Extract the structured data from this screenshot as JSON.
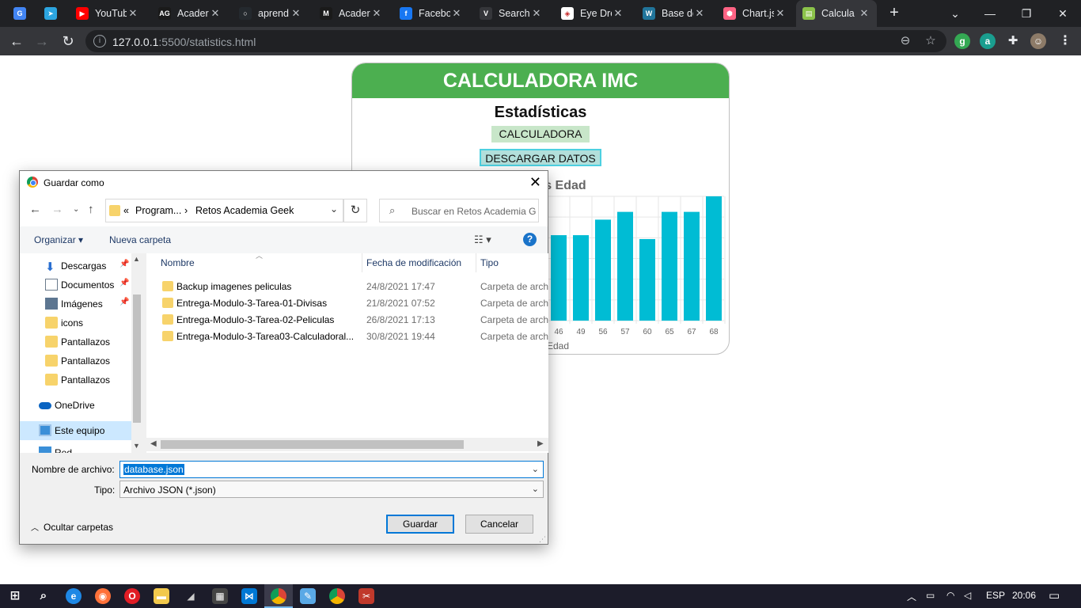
{
  "browser": {
    "tabs": [
      {
        "title": "",
        "color": "#4285f4",
        "glyph": "G"
      },
      {
        "title": "",
        "color": "#2ca5e0",
        "glyph": "➤"
      },
      {
        "title": "YouTub",
        "color": "#ff0000",
        "glyph": "▶"
      },
      {
        "title": "Acader",
        "color": "#1a1a1a",
        "glyph": "AG"
      },
      {
        "title": "aprend",
        "color": "#24292e",
        "glyph": "○"
      },
      {
        "title": "Acader",
        "color": "#1a1a1a",
        "glyph": "M"
      },
      {
        "title": "Facebo",
        "color": "#1877f2",
        "glyph": "f"
      },
      {
        "title": "Search",
        "color": "#35363a",
        "glyph": "V"
      },
      {
        "title": "Eye Dro",
        "color": "#ffffff",
        "glyph": "◈"
      },
      {
        "title": "Base de",
        "color": "#21759b",
        "glyph": "W"
      },
      {
        "title": "Chart.js",
        "color": "#ff6384",
        "glyph": "⬢"
      },
      {
        "title": "Calcula",
        "color": "#8bc34a",
        "glyph": "▤"
      }
    ],
    "url_host": "127.0.0.1",
    "url_path": ":5500/statistics.html"
  },
  "page": {
    "header": "CALCULADORA IMC",
    "subtitle": "Estadísticas",
    "calc_button": "CALCULADORA",
    "download_button": "DESCARGAR DATOS",
    "chart_title_visible": "C vs Edad"
  },
  "chart_data": {
    "type": "bar",
    "title": "IMC vs Edad",
    "xlabel": "Edad",
    "categories": [
      "46",
      "49",
      "56",
      "57",
      "60",
      "65",
      "67",
      "68"
    ],
    "values": [
      22,
      22,
      26,
      28,
      21,
      28,
      28,
      32
    ],
    "ylim": [
      0,
      32
    ],
    "grid": true,
    "bar_color": "#00bcd4"
  },
  "dialog": {
    "title": "Guardar como",
    "path_prefix": "«",
    "path_segment_1": "Program...",
    "path_segment_2": "Retos Academia Geek",
    "search_placeholder": "Buscar en Retos Academia G...",
    "organize": "Organizar ▾",
    "new_folder": "Nueva carpeta",
    "nav_items": [
      {
        "label": "Descargas",
        "pinned": true
      },
      {
        "label": "Documentos",
        "pinned": true
      },
      {
        "label": "Imágenes",
        "pinned": true
      },
      {
        "label": "icons",
        "pinned": false
      },
      {
        "label": "Pantallazos",
        "pinned": false
      },
      {
        "label": "Pantallazos",
        "pinned": false
      },
      {
        "label": "Pantallazos",
        "pinned": false
      },
      {
        "label": "OneDrive",
        "pinned": false
      },
      {
        "label": "Este equipo",
        "pinned": false
      },
      {
        "label": "Red",
        "pinned": false
      }
    ],
    "columns": [
      "Nombre",
      "Fecha de modificación",
      "Tipo"
    ],
    "files": [
      {
        "name": "Backup imagenes peliculas",
        "date": "24/8/2021 17:47",
        "type": "Carpeta de archivos"
      },
      {
        "name": "Entrega-Modulo-3-Tarea-01-Divisas",
        "date": "21/8/2021 07:52",
        "type": "Carpeta de archivos"
      },
      {
        "name": "Entrega-Modulo-3-Tarea-02-Peliculas",
        "date": "26/8/2021 17:13",
        "type": "Carpeta de archivos"
      },
      {
        "name": "Entrega-Modulo-3-Tarea03-Calculadoral...",
        "date": "30/8/2021 19:44",
        "type": "Carpeta de archivos"
      }
    ],
    "filename_label": "Nombre de archivo:",
    "filename_value": "database.json",
    "type_label": "Tipo:",
    "type_value": "Archivo JSON (*.json)",
    "hide_folders": "Ocultar carpetas",
    "save_button": "Guardar",
    "cancel_button": "Cancelar"
  },
  "taskbar": {
    "lang": "ESP",
    "time": "20:06"
  }
}
